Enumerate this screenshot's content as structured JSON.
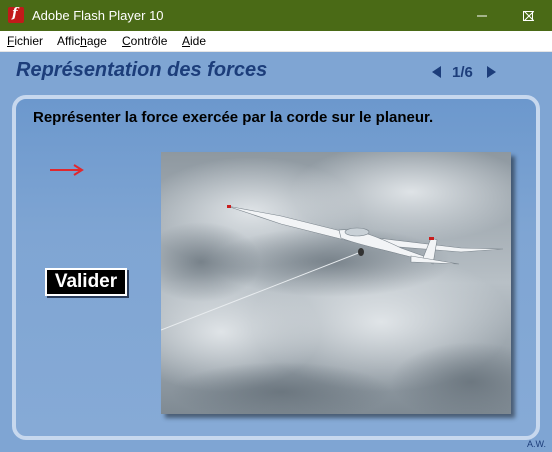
{
  "window": {
    "title": "Adobe Flash Player 10",
    "icon": "flash-player-icon",
    "controls": [
      "minimize-icon",
      "maximize-icon",
      "close-icon"
    ]
  },
  "menu": {
    "items": [
      {
        "label": "Fichier",
        "mnemonic": "F"
      },
      {
        "label": "Affichage",
        "mnemonic": "h"
      },
      {
        "label": "Contrôle",
        "mnemonic": "C"
      },
      {
        "label": "Aide",
        "mnemonic": "A"
      }
    ]
  },
  "content": {
    "title": "Représentation des forces",
    "pagination": "1/6",
    "instruction": "Représenter la force exercée par la corde sur le planeur.",
    "validate_label": "Valider",
    "credit": "A.W.",
    "image_subject": "glider being towed by a rope in a cloudy sky"
  },
  "colors": {
    "titlebar": "#4A6A16",
    "background": "#7FA5D3",
    "heading": "#1C3D7A",
    "force_arrow": "#E0282E"
  }
}
